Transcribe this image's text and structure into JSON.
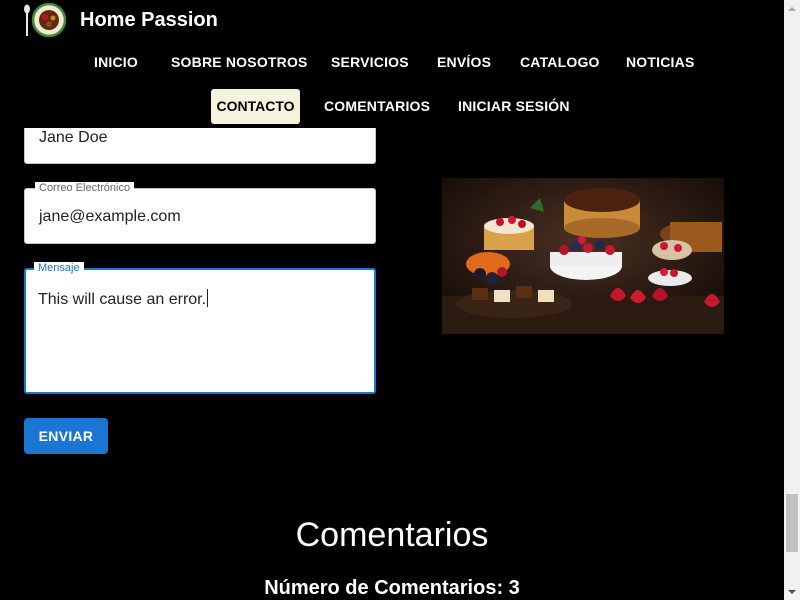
{
  "app": {
    "title": "Home Passion"
  },
  "nav": {
    "row1": [
      "INICIO",
      "SOBRE NOSOTROS",
      "SERVICIOS",
      "ENVÍOS",
      "CATALOGO",
      "NOTICIAS"
    ],
    "active": "CONTACTO",
    "row2": [
      "COMENTARIOS",
      "INICIAR SESIÓN"
    ]
  },
  "form": {
    "name_value": "Jane Doe",
    "email_label": "Correo Electrónico",
    "email_value": "jane@example.com",
    "message_label": "Mensaje",
    "message_value": "This will cause an error.",
    "submit_label": "ENVIAR"
  },
  "comments": {
    "title": "Comentarios",
    "count_text": "Número de Comentarios: 3"
  },
  "colors": {
    "background": "#000000",
    "primary": "#1976d2",
    "active_nav_bg": "#f5f3dc"
  }
}
